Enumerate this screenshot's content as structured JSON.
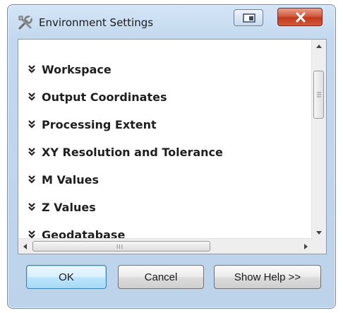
{
  "window": {
    "title": "Environment Settings",
    "close_glyph": "X"
  },
  "icons": {
    "app": "tools-icon",
    "restore": "restore-window-icon",
    "close": "close-icon",
    "expand": "double-chevron-down-icon"
  },
  "sections": [
    {
      "label": "Workspace"
    },
    {
      "label": "Output Coordinates"
    },
    {
      "label": "Processing Extent"
    },
    {
      "label": "XY Resolution and Tolerance"
    },
    {
      "label": "M Values"
    },
    {
      "label": "Z Values"
    },
    {
      "label": "Geodatabase"
    }
  ],
  "scrollbar": {
    "horizontal_grip": "III"
  },
  "buttons": {
    "ok": "OK",
    "cancel": "Cancel",
    "help": "Show Help >>"
  },
  "colors": {
    "title_gradient_top": "#d4e5f6",
    "close_red": "#c2391d",
    "default_button_blue": "#3c7fb1"
  }
}
